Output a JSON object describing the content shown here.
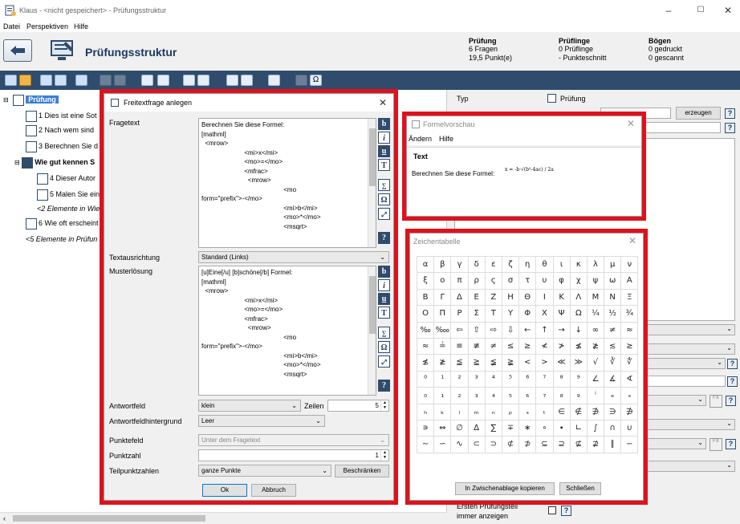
{
  "window": {
    "title": "Klaus - <nicht gespeichert> - Prüfungsstruktur",
    "controls": [
      "–",
      "☐",
      "✕"
    ]
  },
  "menu": [
    "Datei",
    "Perspektiven",
    "Hilfe"
  ],
  "header": {
    "title": "Prüfungsstruktur",
    "stats": [
      {
        "heading": "Prüfung",
        "lines": [
          "6 Fragen",
          "19,5 Punkt(e)"
        ]
      },
      {
        "heading": "Prüflinge",
        "lines": [
          "0 Prüflinge",
          "- Punkteschnitt"
        ]
      },
      {
        "heading": "Bögen",
        "lines": [
          "0 gedruckt",
          "0 gescannt"
        ]
      }
    ]
  },
  "tree": {
    "root": "Prüfung",
    "items": [
      "1 Dies ist eine Sot",
      "2 Nach wem sind",
      "3 Berechnen Sie d",
      "Wie gut kennen S",
      "4 Dieser Autor",
      "5 Malen Sie ein",
      "<2 Elemente in Wie",
      "6 Wie oft erscheint",
      "<5 Elemente in Prüfun"
    ]
  },
  "rightpane": {
    "typ_label": "Typ",
    "typ_value": "Prüfung",
    "generate_button": "erzeugen",
    "bottom_label_line1": "Ersten Prüfungsteil",
    "bottom_label_line2": "immer anzeigen",
    "fx_glyph": "FX"
  },
  "dialog_freitext": {
    "title": "Freitextfrage anlegen",
    "fragetext_label": "Fragetext",
    "fragetext": "Berechnen Sie diese Formel:\n[mathml]\n  <mrow>\n                        <mi>x</mi>\n                        <mo>=</mo>\n                        <mfrac>\n                          <mrow>\n                                              <mo\nform=\"prefix\">-</mo>\n                                              <mi>b</mi>\n                                              <mo>*</mo>\n                                              <msqrt>",
    "textausrichtung_label": "Textausrichtung",
    "textausrichtung_value": "Standard (Links)",
    "musterloesung_label": "Musterlösung",
    "musterloesung": "[u]Eine[/u] [b]schöne[/b] Formel:\n[mathml]\n  <mrow>\n                        <mi>x</mi>\n                        <mo>=</mo>\n                        <mfrac>\n                          <mrow>\n                                              <mo\nform=\"prefix\">-</mo>\n                                              <mi>b</mi>\n                                              <mo>*</mo>\n                                              <msqrt>",
    "format_buttons": [
      "b",
      "i",
      "u",
      "T"
    ],
    "antwortfeld_label": "Antwortfeld",
    "antwortfeld_value": "klein",
    "zeilen_label": "Zeilen",
    "zeilen_value": "5",
    "hintergrund_label": "Antwortfeldhintergrund",
    "hintergrund_value": "Leer",
    "punktefeld_label": "Punktefeld",
    "punktefeld_value": "Unter dem Fragetext",
    "punktzahl_label": "Punktzahl",
    "punktzahl_value": "1",
    "teilpunkt_label": "Teilpunktzahlen",
    "teilpunkt_value": "ganze Punkte",
    "beschraenken_button": "Beschränken",
    "ok_button": "Ok",
    "abbruch_button": "Abbruch"
  },
  "dialog_formel": {
    "title": "Formelvorschau",
    "menu": [
      "Ändern",
      "Hilfe"
    ],
    "heading": "Text",
    "body": "Berechnen Sie diese Formel:",
    "formula": "x = -b·√(b²-4ac) / 2a"
  },
  "dialog_zeichen": {
    "title": "Zeichentabelle",
    "symbols": [
      "α",
      "β",
      "γ",
      "δ",
      "ε",
      "ζ",
      "η",
      "θ",
      "ι",
      "κ",
      "λ",
      "μ",
      "ν",
      "ξ",
      "ο",
      "π",
      "ρ",
      "ς",
      "σ",
      "τ",
      "υ",
      "φ",
      "χ",
      "ψ",
      "ω",
      "Α",
      "Β",
      "Γ",
      "Δ",
      "Ε",
      "Ζ",
      "Η",
      "Θ",
      "Ι",
      "Κ",
      "Λ",
      "Μ",
      "Ν",
      "Ξ",
      "Ο",
      "Π",
      "Ρ",
      "Σ",
      "Τ",
      "Υ",
      "Φ",
      "Χ",
      "Ψ",
      "Ω",
      "¼",
      "½",
      "¾",
      "‰",
      "‱",
      "⇦",
      "⇧",
      "⇨",
      "⇩",
      "←",
      "↑",
      "→",
      "↓",
      "∞",
      "≠",
      "≈",
      "≈",
      "≟",
      "≡",
      "≢",
      "≠",
      "≤",
      "≥",
      "≮",
      "≯",
      "≰",
      "≱",
      "≲",
      "≳",
      "≴",
      "≵",
      "≦",
      "≧",
      "≨",
      "≩",
      "<",
      ">",
      "≪",
      "≫",
      "√",
      "∛",
      "∜",
      "⁰",
      "¹",
      "²",
      "³",
      "⁴",
      "⁵",
      "⁶",
      "⁷",
      "⁸",
      "⁹",
      "∠",
      "∡",
      "∢",
      "₀",
      "₁",
      "₂",
      "₃",
      "₄",
      "₅",
      "₆",
      "₇",
      "₈",
      "₉",
      "ⁱ",
      "ₑ",
      "ₓ",
      "ₕ",
      "ₖ",
      "ₗ",
      "ₘ",
      "ₙ",
      "ₚ",
      "ₛ",
      "ₜ",
      "∈",
      "∉",
      "∌",
      "∋",
      "∌",
      "∍",
      "⇔",
      "∅",
      "∆",
      "∑",
      "∓",
      "∗",
      "∘",
      "∙",
      "∟",
      "∫",
      "∩",
      "∪",
      "∼",
      "∽",
      "∿",
      "⊂",
      "⊃",
      "⊄",
      "⊅",
      "⊆",
      "⊇",
      "⊈",
      "⊉",
      "∥",
      "−"
    ],
    "copy_button": "In Zwischenablage kopieren",
    "close_button": "Schließen"
  }
}
